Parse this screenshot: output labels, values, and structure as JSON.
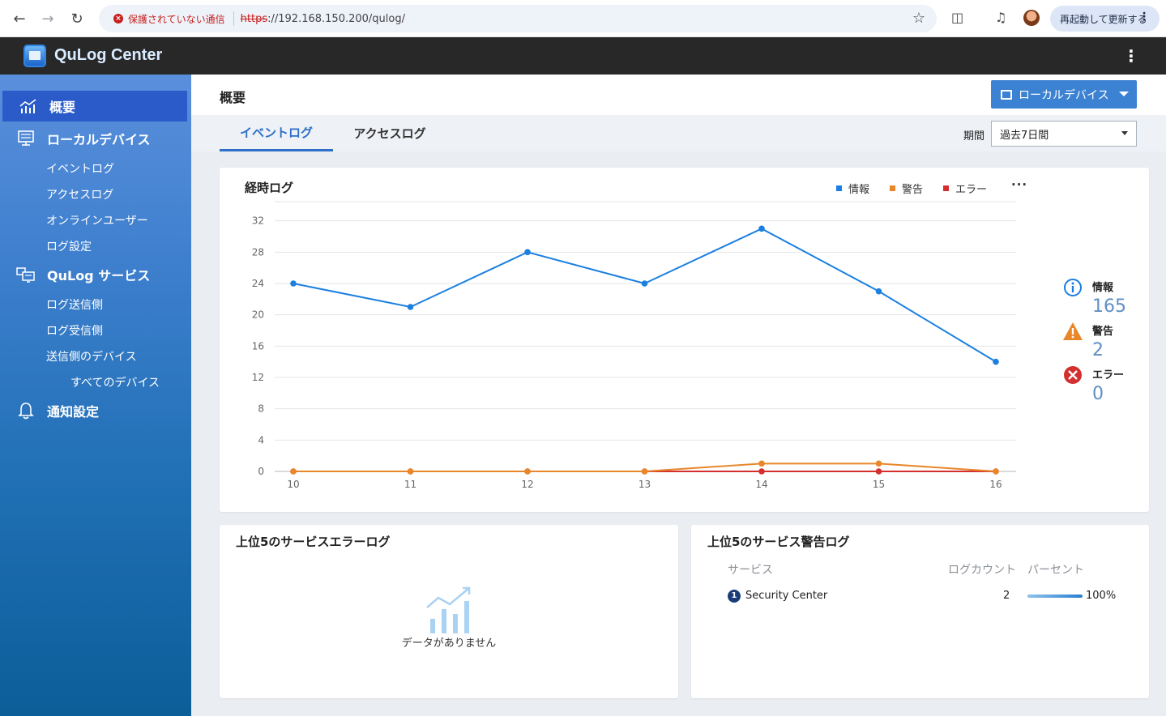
{
  "browser": {
    "insecure_label": "保護されていない通信",
    "url_scheme": "https",
    "url_rest": "://192.168.150.200/qulog/",
    "restart_label": "再起動して更新する"
  },
  "app": {
    "title": "QuLog Center"
  },
  "sidebar": {
    "overview": "概要",
    "local_device": "ローカルデバイス",
    "local_items": [
      "イベントログ",
      "アクセスログ",
      "オンラインユーザー",
      "ログ設定"
    ],
    "qulog_service": "QuLog サービス",
    "service_items": [
      "ログ送信側",
      "ログ受信側",
      "送信側のデバイス"
    ],
    "all_devices": "すべてのデバイス",
    "notification": "通知設定"
  },
  "header": {
    "page_title": "概要",
    "device_button": "ローカルデバイス"
  },
  "tabs": [
    {
      "label": "イベントログ",
      "active": true
    },
    {
      "label": "アクセスログ",
      "active": false
    }
  ],
  "period": {
    "label": "期間",
    "value": "過去7日間"
  },
  "timeline": {
    "title": "経時ログ",
    "legend": [
      {
        "label": "情報",
        "color": "#1a7fe0"
      },
      {
        "label": "警告",
        "color": "#e8872a"
      },
      {
        "label": "エラー",
        "color": "#d32f2f"
      }
    ],
    "more": "···"
  },
  "chart_data": {
    "type": "line",
    "x": [
      10,
      11,
      12,
      13,
      14,
      15,
      16
    ],
    "series": [
      {
        "name": "情報",
        "values": [
          24,
          21,
          28,
          24,
          31,
          23,
          14
        ],
        "color": "#1a7fe0"
      },
      {
        "name": "警告",
        "values": [
          0,
          0,
          0,
          0,
          1,
          1,
          0
        ],
        "color": "#e8872a"
      },
      {
        "name": "エラー",
        "values": [
          0,
          0,
          0,
          0,
          0,
          0,
          0
        ],
        "color": "#d32f2f"
      }
    ],
    "yticks": [
      0,
      4,
      8,
      12,
      16,
      20,
      24,
      28,
      32
    ],
    "ylim": [
      0,
      33
    ],
    "grid": true
  },
  "summary": [
    {
      "label": "情報",
      "value": "165",
      "icon": "info-icon",
      "color": "#1a7fe0"
    },
    {
      "label": "警告",
      "value": "2",
      "icon": "warning-icon",
      "color": "#e8872a"
    },
    {
      "label": "エラー",
      "value": "0",
      "icon": "error-icon",
      "color": "#d32f2f"
    }
  ],
  "error_card": {
    "title": "上位5のサービスエラーログ",
    "empty": "データがありません"
  },
  "warning_card": {
    "title": "上位5のサービス警告ログ",
    "col_service": "サービス",
    "col_count": "ログカウント",
    "col_percent": "パーセント",
    "rows": [
      {
        "rank": "1",
        "service": "Security Center",
        "count": "2",
        "percent": "100%",
        "percent_value": 100
      }
    ]
  }
}
